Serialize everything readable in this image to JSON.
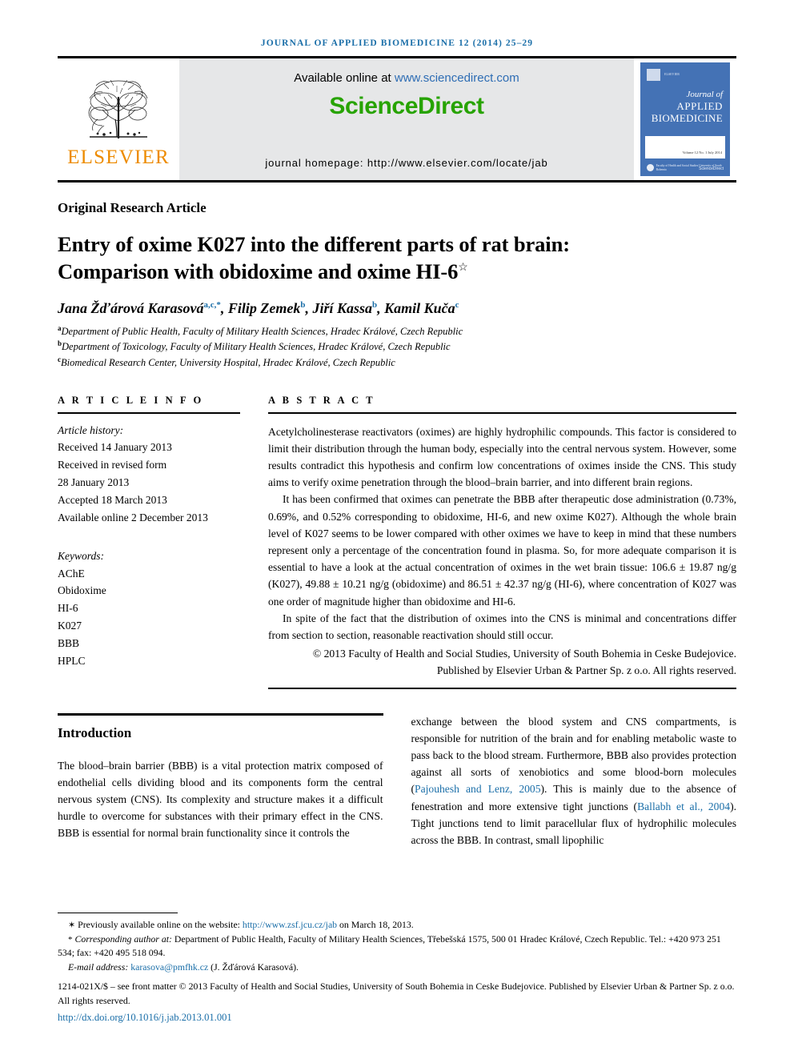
{
  "running_head": "JOURNAL OF APPLIED BIOMEDICINE 12 (2014) 25–29",
  "masthead": {
    "publisher": "ELSEVIER",
    "available_prefix": "Available online at ",
    "available_link": "www.sciencedirect.com",
    "brand": "ScienceDirect",
    "homepage": "journal homepage: http://www.elsevier.com/locate/jab",
    "cover": {
      "line1": "Journal of",
      "line2": "APPLIED",
      "line3": "BIOMEDICINE",
      "top_text": "ELSEVIER",
      "volume": "Volume 12\nNo. 1\nJuly 2014",
      "org": "Faculty of Health\nand Social Studies\nUniversity of South Bohemia",
      "sciencedirect": "ScienceDirect"
    }
  },
  "article": {
    "type": "Original Research Article",
    "title_line1": "Entry of oxime K027 into the different parts of rat brain:",
    "title_line2": "Comparison with obidoxime and oxime HI-6",
    "title_star": "☆",
    "authors": [
      {
        "name": "Jana Žďárová Karasová",
        "marks": "a,c,*"
      },
      {
        "name": "Filip Zemek",
        "marks": "b"
      },
      {
        "name": "Jiří Kassa",
        "marks": "b"
      },
      {
        "name": "Kamil Kuča",
        "marks": "c"
      }
    ],
    "affiliations": [
      {
        "mark": "a",
        "text": "Department of Public Health, Faculty of Military Health Sciences, Hradec Králové, Czech Republic"
      },
      {
        "mark": "b",
        "text": "Department of Toxicology, Faculty of Military Health Sciences, Hradec Králové, Czech Republic"
      },
      {
        "mark": "c",
        "text": "Biomedical Research Center, University Hospital, Hradec Králové, Czech Republic"
      }
    ]
  },
  "article_info": {
    "heading": "A R T I C L E   I N F O",
    "history_label": "Article history:",
    "history": [
      "Received 14 January 2013",
      "Received in revised form",
      "28 January 2013",
      "Accepted 18 March 2013",
      "Available online 2 December 2013"
    ],
    "keywords_label": "Keywords:",
    "keywords": [
      "AChE",
      "Obidoxime",
      "HI-6",
      "K027",
      "BBB",
      "HPLC"
    ]
  },
  "abstract": {
    "heading": "A B S T R A C T",
    "paragraphs": [
      "Acetylcholinesterase reactivators (oximes) are highly hydrophilic compounds. This factor is considered to limit their distribution through the human body, especially into the central nervous system. However, some results contradict this hypothesis and confirm low concentrations of oximes inside the CNS. This study aims to verify oxime penetration through the blood–brain barrier, and into different brain regions.",
      "It has been confirmed that oximes can penetrate the BBB after therapeutic dose administration (0.73%, 0.69%, and 0.52% corresponding to obidoxime, HI-6, and new oxime K027). Although the whole brain level of K027 seems to be lower compared with other oximes we have to keep in mind that these numbers represent only a percentage of the concentration found in plasma. So, for more adequate comparison it is essential to have a look at the actual concentration of oximes in the wet brain tissue: 106.6 ± 19.87 ng/g (K027), 49.88 ± 10.21 ng/g (obidoxime) and 86.51 ± 42.37 ng/g (HI-6), where concentration of K027 was one order of magnitude higher than obidoxime and HI-6.",
      "In spite of the fact that the distribution of oximes into the CNS is minimal and concentrations differ from section to section, reasonable reactivation should still occur."
    ],
    "copyright": "© 2013 Faculty of Health and Social Studies, University of South Bohemia in Ceske Budejovice. Published by Elsevier Urban & Partner Sp. z o.o. All rights reserved."
  },
  "introduction": {
    "heading": "Introduction",
    "left_text": "The blood–brain barrier (BBB) is a vital protection matrix composed of endothelial cells dividing blood and its components form the central nervous system (CNS). Its complexity and structure makes it a difficult hurdle to overcome for substances with their primary effect in the CNS. BBB is essential for normal brain functionality since it controls the",
    "right_pre1": "exchange between the blood system and CNS compartments, is responsible for nutrition of the brain and for enabling metabolic waste to pass back to the blood stream. Furthermore, BBB also provides protection against all sorts of xenobiotics and some blood-born molecules (",
    "right_cite1": "Pajouhesh and Lenz, 2005",
    "right_pre2": "). This is mainly due to the absence of fenestration and more extensive tight junctions (",
    "right_cite2": "Ballabh et al., 2004",
    "right_post": "). Tight junctions tend to limit paracellular flux of hydrophilic molecules across the BBB. In contrast, small lipophilic"
  },
  "footnotes": {
    "star_mark": "✶",
    "star_pre": " Previously available online on the website: ",
    "star_link": "http://www.zsf.jcu.cz/jab",
    "star_post": " on March 18, 2013.",
    "corr_mark": "*",
    "corr_label": " Corresponding author at:",
    "corr_text": " Department of Public Health, Faculty of Military Health Sciences, Třebešská 1575, 500 01 Hradec Králové, Czech Republic. Tel.: +420 973 251 534; fax: +420 495 518 094.",
    "email_label": "E-mail address: ",
    "email": "karasova@pmfhk.cz",
    "email_suffix": " (J. Žďárová Karasová).",
    "frontmatter": "1214-021X/$ – see front matter © 2013 Faculty of Health and Social Studies, University of South Bohemia in Ceske Budejovice. Published by Elsevier Urban & Partner Sp. z o.o. All rights reserved.",
    "doi": "http://dx.doi.org/10.1016/j.jab.2013.01.001"
  },
  "colors": {
    "link": "#1a6ea8",
    "elsevier_orange": "#ED8B00",
    "sciencedirect_green": "#27a300",
    "cover_blue": "#4472b5",
    "masthead_grey": "#e6e7e8"
  }
}
